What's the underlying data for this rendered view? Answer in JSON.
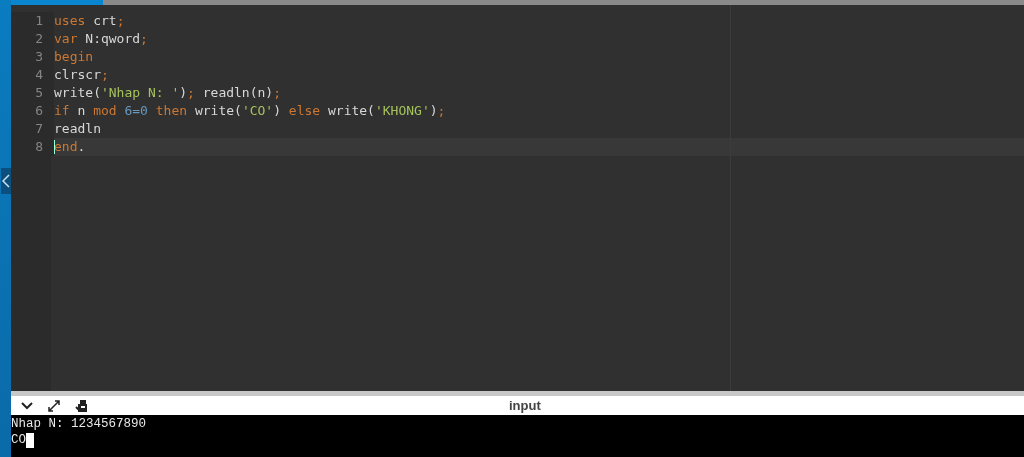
{
  "editor": {
    "lines": [
      {
        "number": "1",
        "current": false,
        "tokens": [
          {
            "kind": "keyword",
            "text": "uses"
          },
          {
            "kind": "text",
            "text": " crt"
          },
          {
            "kind": "punct",
            "text": ";"
          }
        ]
      },
      {
        "number": "2",
        "current": false,
        "tokens": [
          {
            "kind": "keyword",
            "text": "var"
          },
          {
            "kind": "text",
            "text": " N:qword"
          },
          {
            "kind": "punct",
            "text": ";"
          }
        ]
      },
      {
        "number": "3",
        "current": false,
        "tokens": [
          {
            "kind": "keyword",
            "text": "begin"
          }
        ]
      },
      {
        "number": "4",
        "current": false,
        "tokens": [
          {
            "kind": "text",
            "text": "clrscr"
          },
          {
            "kind": "punct",
            "text": ";"
          }
        ]
      },
      {
        "number": "5",
        "current": false,
        "tokens": [
          {
            "kind": "text",
            "text": "write("
          },
          {
            "kind": "string",
            "text": "'Nhap N: '"
          },
          {
            "kind": "text",
            "text": ")"
          },
          {
            "kind": "punct",
            "text": ";"
          },
          {
            "kind": "text",
            "text": " readln(n)"
          },
          {
            "kind": "punct",
            "text": ";"
          }
        ]
      },
      {
        "number": "6",
        "current": false,
        "tokens": [
          {
            "kind": "keyword",
            "text": "if"
          },
          {
            "kind": "text",
            "text": " n "
          },
          {
            "kind": "keyword",
            "text": "mod"
          },
          {
            "kind": "number",
            "text": " 6=0"
          },
          {
            "kind": "keyword",
            "text": " then"
          },
          {
            "kind": "text",
            "text": " write("
          },
          {
            "kind": "string",
            "text": "'CO'"
          },
          {
            "kind": "text",
            "text": ") "
          },
          {
            "kind": "keyword",
            "text": "else"
          },
          {
            "kind": "text",
            "text": " write("
          },
          {
            "kind": "string",
            "text": "'KHONG'"
          },
          {
            "kind": "text",
            "text": ")"
          },
          {
            "kind": "punct",
            "text": ";"
          }
        ]
      },
      {
        "number": "7",
        "current": false,
        "tokens": [
          {
            "kind": "text",
            "text": "readln"
          }
        ]
      },
      {
        "number": "8",
        "current": true,
        "tokens": [
          {
            "kind": "keyword",
            "text": "end"
          },
          {
            "kind": "text",
            "text": "."
          }
        ]
      }
    ]
  },
  "console": {
    "title": "input",
    "lines": [
      "Nhap N: 1234567890",
      "CO"
    ],
    "cursor": true
  }
}
